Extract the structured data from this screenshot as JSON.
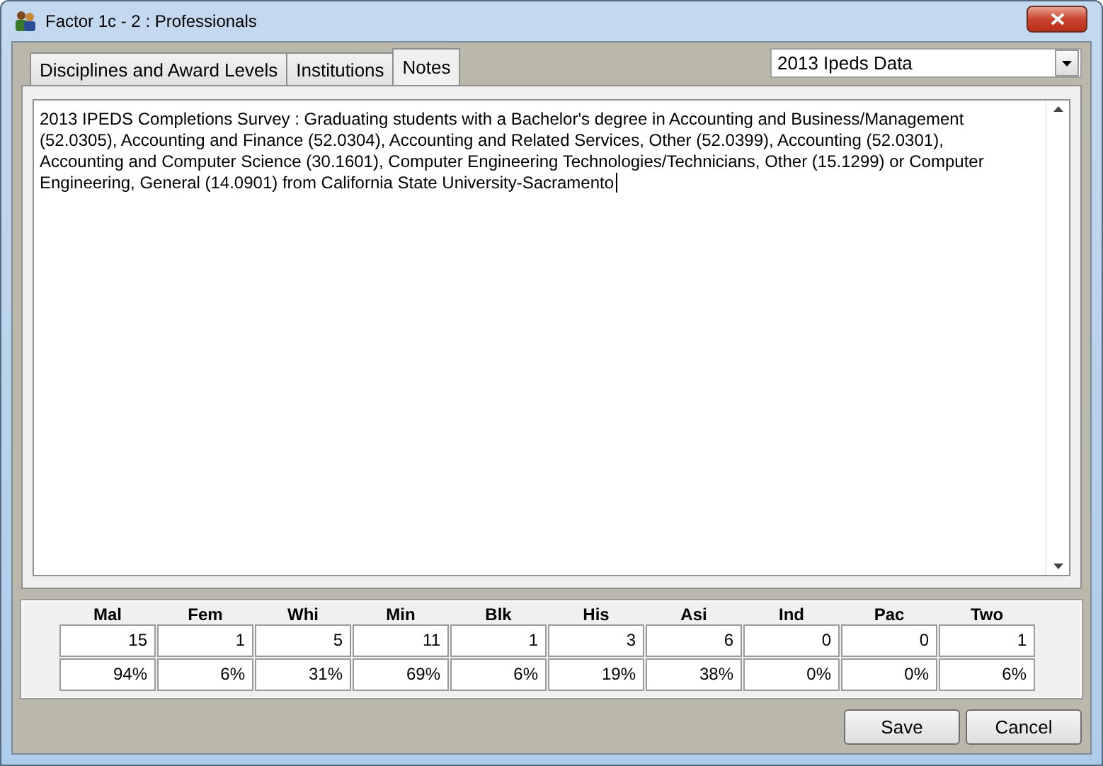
{
  "window": {
    "title": "Factor 1c - 2 : Professionals"
  },
  "tabs": [
    {
      "label": "Disciplines and Award Levels",
      "selected": false
    },
    {
      "label": "Institutions",
      "selected": false
    },
    {
      "label": "Notes",
      "selected": true
    }
  ],
  "source_dropdown": {
    "value": "2013 Ipeds Data"
  },
  "notes": {
    "value": "2013 IPEDS Completions Survey : Graduating students with a Bachelor's degree in Accounting and Business/Management (52.0305), Accounting and Finance (52.0304), Accounting and Related Services, Other (52.0399), Accounting (52.0301), Accounting and Computer Science (30.1601), Computer Engineering Technologies/Technicians, Other (15.1299) or Computer Engineering, General (14.0901) from California State University-Sacramento"
  },
  "stats": [
    {
      "label": "Mal",
      "count": "15",
      "percent": "94%"
    },
    {
      "label": "Fem",
      "count": "1",
      "percent": "6%"
    },
    {
      "label": "Whi",
      "count": "5",
      "percent": "31%"
    },
    {
      "label": "Min",
      "count": "11",
      "percent": "69%"
    },
    {
      "label": "Blk",
      "count": "1",
      "percent": "6%"
    },
    {
      "label": "His",
      "count": "3",
      "percent": "19%"
    },
    {
      "label": "Asi",
      "count": "6",
      "percent": "38%"
    },
    {
      "label": "Ind",
      "count": "0",
      "percent": "0%"
    },
    {
      "label": "Pac",
      "count": "0",
      "percent": "0%"
    },
    {
      "label": "Two",
      "count": "1",
      "percent": "6%"
    }
  ],
  "buttons": [
    "Save",
    "Cancel"
  ]
}
